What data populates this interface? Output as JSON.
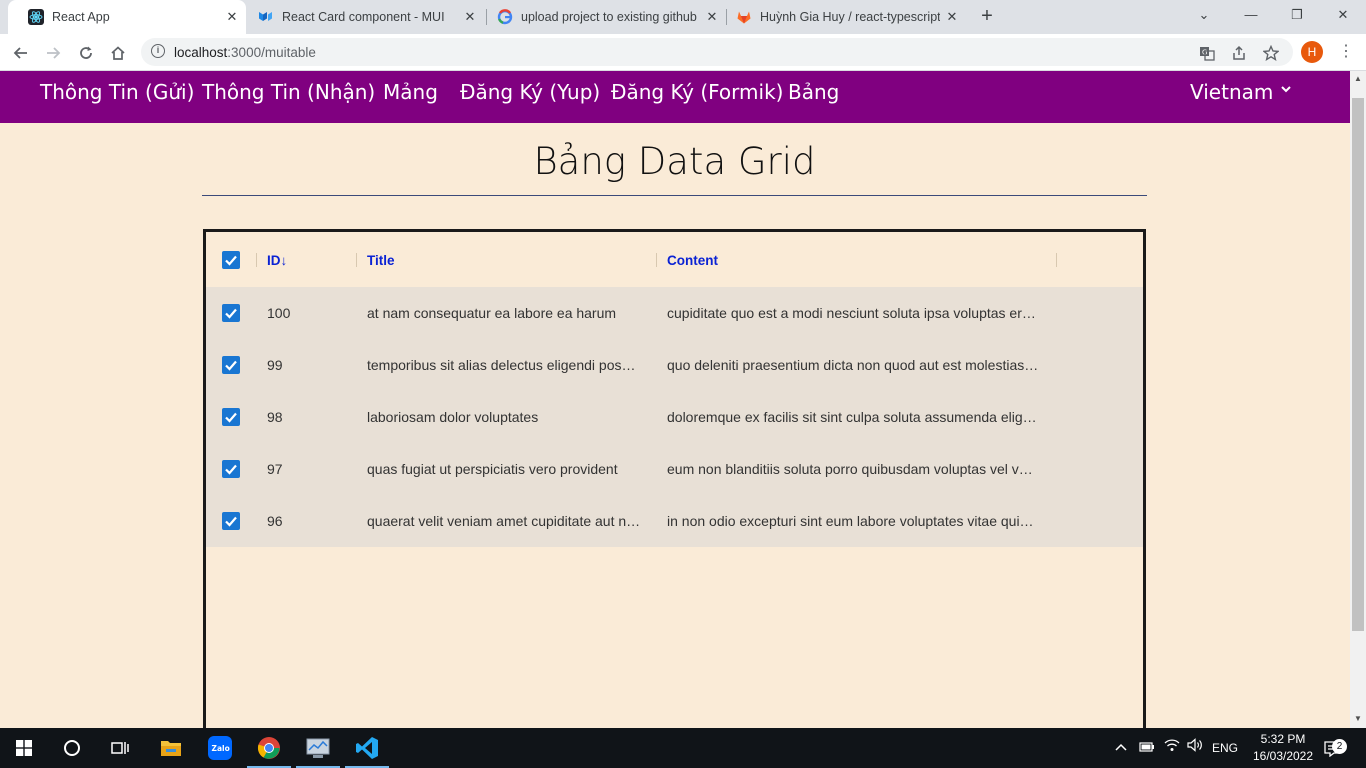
{
  "browser": {
    "tabs": [
      {
        "title": "React App",
        "icon": "react-icon",
        "active": true
      },
      {
        "title": "React Card component - MUI",
        "icon": "mui-icon",
        "active": false
      },
      {
        "title": "upload project to existing github",
        "icon": "google-icon",
        "active": false
      },
      {
        "title": "Huỳnh Gia Huy / react-typescript",
        "icon": "gitlab-icon",
        "active": false
      }
    ],
    "url_host": "localhost",
    "url_path": ":3000/muitable",
    "profile_initial": "H"
  },
  "appnav": {
    "items": [
      "Thông Tin (Gửi)",
      "Thông Tin (Nhận)",
      "Mảng",
      "Đăng Ký (Yup)",
      "Đăng Ký (Formik)",
      "Bảng"
    ],
    "country": "Vietnam"
  },
  "page": {
    "title": "Bảng Data Grid"
  },
  "grid": {
    "columns": [
      "ID",
      "Title",
      "Content"
    ],
    "sort_indicator": "↓",
    "rows": [
      {
        "id": "100",
        "title": "at nam consequatur ea labore ea harum",
        "content": "cupiditate quo est a modi nesciunt soluta ipsa voluptas er…"
      },
      {
        "id": "99",
        "title": "temporibus sit alias delectus eligendi pos…",
        "content": "quo deleniti praesentium dicta non quod aut est molestias…"
      },
      {
        "id": "98",
        "title": "laboriosam dolor voluptates",
        "content": "doloremque ex facilis sit sint culpa soluta assumenda elig…"
      },
      {
        "id": "97",
        "title": "quas fugiat ut perspiciatis vero provident",
        "content": "eum non blanditiis soluta porro quibusdam voluptas vel v…"
      },
      {
        "id": "96",
        "title": "quaerat velit veniam amet cupiditate aut n…",
        "content": "in non odio excepturi sint eum labore voluptates vitae qui…"
      }
    ]
  },
  "taskbar": {
    "tray_lang": "ENG",
    "time": "5:32 PM",
    "date": "16/03/2022",
    "notification_count": "2"
  },
  "colors": {
    "navbar": "#800080",
    "page_background": "#faebd7",
    "checkbox": "#1976d2",
    "header_text": "#0a22d4"
  }
}
